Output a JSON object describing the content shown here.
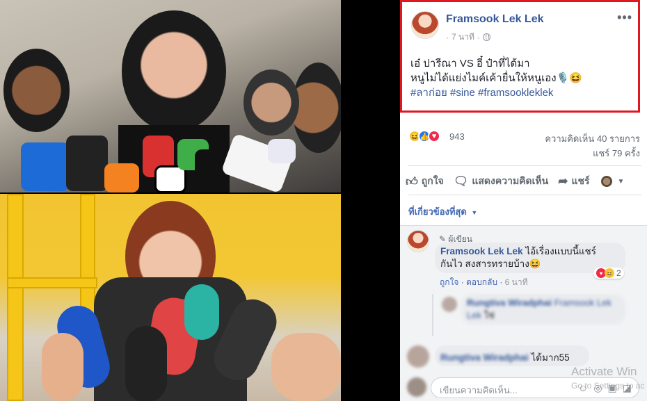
{
  "post": {
    "author": "Framsook Lek Lek",
    "time": "7 นาที",
    "time_separator": "·",
    "line1": "เอ๋ ปารีณา VS อี๋ ป๋าที่ได้มา",
    "line2": "หนูไม่ได้แย่งไมค์เค้ายื่นให้หนูเอง🎙️😆",
    "hashtags": "#ลาก่อย #sine #framsookleklek",
    "more_icon": "more-horizontal-icon"
  },
  "stats": {
    "reaction_count": "943",
    "comments": "ความคิดเห็น 40 รายการ",
    "shares": "แชร์ 79 ครั้ง"
  },
  "actions": {
    "like": "ถูกใจ",
    "comment": "แสดงความคิดเห็น",
    "share": "แชร์"
  },
  "filter": {
    "label": "ที่เกี่ยวข้องที่สุด"
  },
  "comment1": {
    "badge": "ผู้เขียน",
    "author": "Framsook Lek Lek",
    "text_a": "ไอ้เรื่องแบบนี้แชร์",
    "text_b": "กันไว สงสารทรายบ้าง😆",
    "reaction_count": "2",
    "like": "ถูกใจ",
    "reply": "ตอบกลับ",
    "time": "6 นาที",
    "separator": "·"
  },
  "reply1": {
    "author": "Rungtiva Wiradphai",
    "mention": "Framsook Lek Lek",
    "text": "ใช่"
  },
  "comment2": {
    "author": "Rungtiva Wiradphai",
    "text": "ได้มาก55"
  },
  "input": {
    "placeholder": "เขียนความคิดเห็น..."
  },
  "watermark": {
    "title": "Activate Win",
    "sub": "Go to Settings to ac"
  },
  "colors": {
    "accent": "#365899",
    "highlight_border": "#e0171f",
    "link": "#4267b2"
  }
}
